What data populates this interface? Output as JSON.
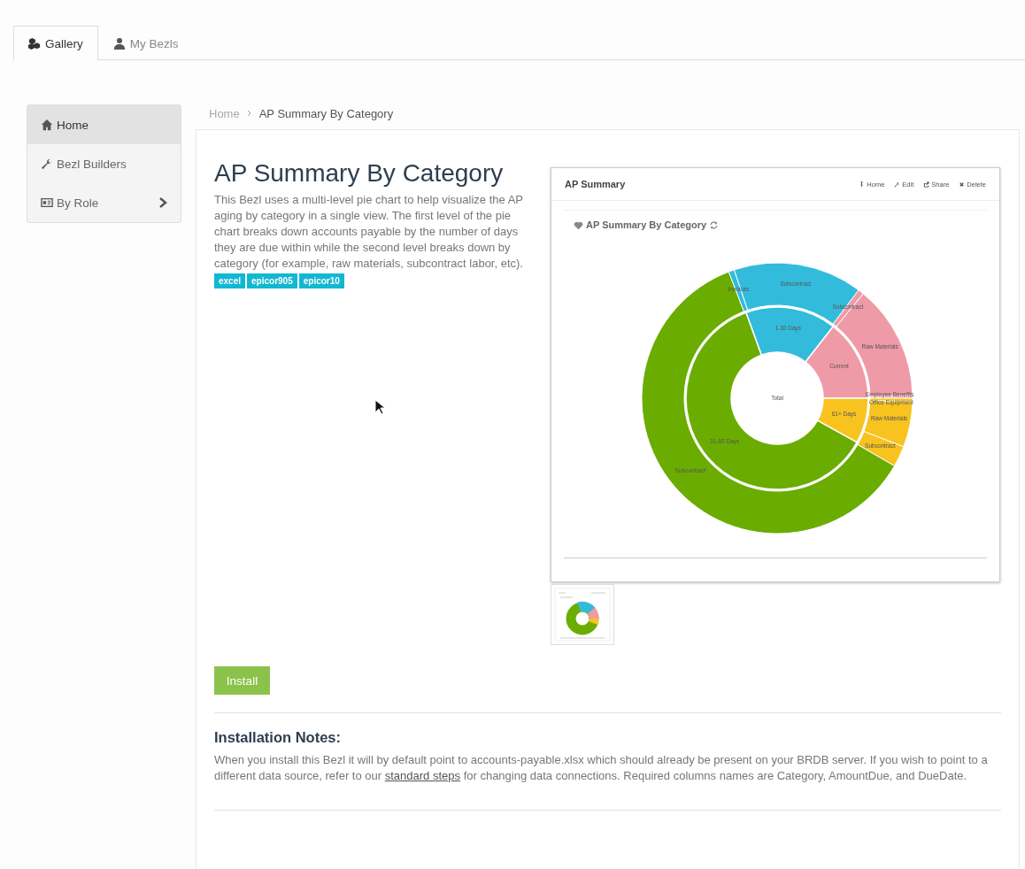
{
  "tabs": [
    {
      "label": "Gallery",
      "selected": true
    },
    {
      "label": "My Bezls",
      "selected": false
    }
  ],
  "sidebar": {
    "items": [
      {
        "label": "Home",
        "selected": true,
        "has_children": false
      },
      {
        "label": "Bezl Builders",
        "selected": false,
        "has_children": false
      },
      {
        "label": "By Role",
        "selected": false,
        "has_children": true
      }
    ]
  },
  "breadcrumb": [
    "Home",
    "AP Summary By Category"
  ],
  "title": "AP Summary By Category",
  "description": "This Bezl uses a multi-level pie chart to help visualize the AP aging by category in a single view. The first level of the pie chart breaks down accounts payable by the number of days they are due within while the second level breaks down by category (for example, raw materials, subcontract labor, etc).",
  "tags": [
    "excel",
    "epicor905",
    "epicor10"
  ],
  "preview": {
    "title": "AP Summary",
    "actions": [
      {
        "label": "Home"
      },
      {
        "label": "Edit"
      },
      {
        "label": "Share"
      },
      {
        "label": "Delete"
      }
    ],
    "chart_title": "AP Summary By Category",
    "center_label": "Total",
    "inner": [
      {
        "label": "1-30 Days",
        "color": "#33bbdc"
      },
      {
        "label": "Current",
        "color": "#ef9aa7"
      },
      {
        "label": "61+ Days",
        "color": "#f8c21f"
      },
      {
        "label": "31-60 Days",
        "color": "#6aad00"
      }
    ],
    "outer": [
      {
        "label": "Invoices",
        "color": "#33bbdc"
      },
      {
        "label": "Subcontract",
        "color": "#33bbdc"
      },
      {
        "label": "Subcontract",
        "color": "#ef9aa7"
      },
      {
        "label": "Raw Materials",
        "color": "#ef9aa7"
      },
      {
        "label": "Employee Benefits",
        "color": "#ef9aa7"
      },
      {
        "label": "Office Equipment",
        "color": "#f8c21f"
      },
      {
        "label": "Raw Materials",
        "color": "#f8c21f"
      },
      {
        "label": "Subcontract",
        "color": "#f8c21f"
      },
      {
        "label": "Subcontract",
        "color": "#6aad00"
      }
    ]
  },
  "install_button": "Install",
  "notes": {
    "heading": "Installation Notes:",
    "text_before": "When you install this Bezl it will by default point to accounts-payable.xlsx which should already be present on your BRDB server. If you wish to point to a different data source, refer to our",
    "link": "standard steps",
    "text_after": "for changing data connections. Required columns names are Category, AmountDue, and DueDate."
  }
}
